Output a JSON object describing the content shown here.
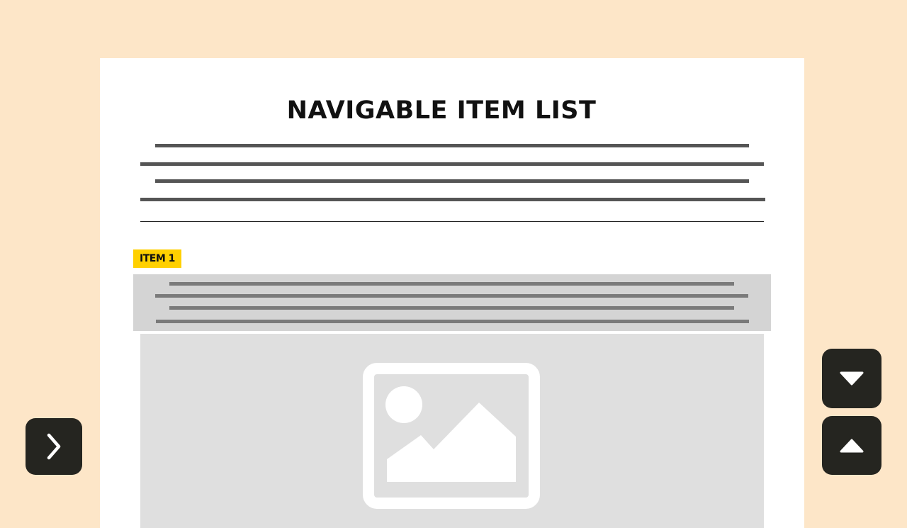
{
  "title": "NAVIGABLE ITEM LIST",
  "items": [
    {
      "label": "ITEM 1"
    }
  ],
  "controls": {
    "next_icon": "chevron-right-icon",
    "down_icon": "caret-down-icon",
    "up_icon": "caret-up-icon"
  },
  "colors": {
    "background": "#fde6c8",
    "card": "#ffffff",
    "badge": "#ffd000",
    "button": "#252520"
  }
}
